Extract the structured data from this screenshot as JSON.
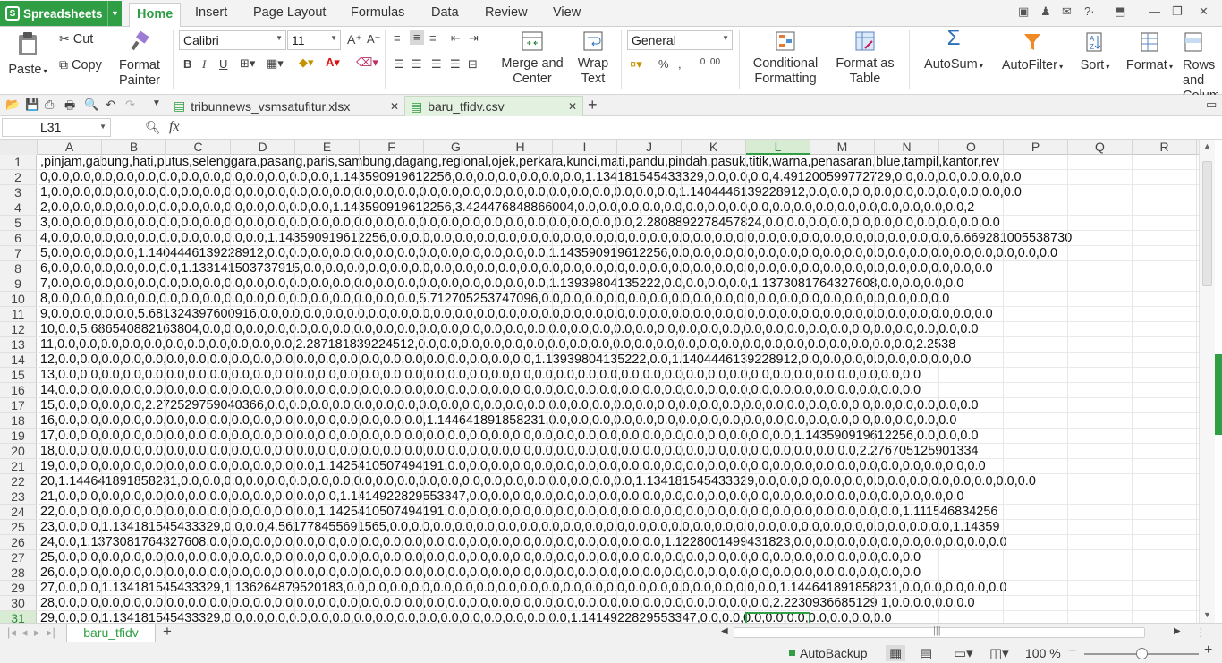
{
  "app": {
    "name": "Spreadsheets",
    "menu": [
      "Home",
      "Insert",
      "Page Layout",
      "Formulas",
      "Data",
      "Review",
      "View"
    ]
  },
  "ribbon": {
    "paste": "Paste",
    "cut": "Cut",
    "copy": "Copy",
    "format_painter": "Format Painter",
    "font_name": "Calibri",
    "font_size": "11",
    "merge_center": "Merge and Center",
    "wrap_text": "Wrap Text",
    "number_format": "General",
    "conditional_formatting": "Conditional Formatting",
    "format_as_table": "Format as Table",
    "autosum": "AutoSum",
    "autofilter": "AutoFilter",
    "sort": "Sort",
    "format": "Format",
    "rows_cols": "Rows and Columns"
  },
  "doc_tabs": [
    {
      "name": "tribunnews_vsmsatufitur.xlsx",
      "active": false
    },
    {
      "name": "baru_tfidv.csv",
      "active": true
    }
  ],
  "formula_bar": {
    "cell_ref": "L31",
    "fx": "fx",
    "value": ""
  },
  "columns": [
    "A",
    "B",
    "C",
    "D",
    "E",
    "F",
    "G",
    "H",
    "I",
    "J",
    "K",
    "L",
    "M",
    "N",
    "O",
    "P",
    "Q",
    "R"
  ],
  "selected_column": "L",
  "rows": [
    {
      "n": "1",
      "text": ",pinjam,gabung,hati,putus,selenggara,pasang,paris,sambung,dagang,regional,ojek,perkara,kunci,mati,pandu,pindah,pasuk,titik,warna,penasaran,blue,tampil,kantor,rev"
    },
    {
      "n": "2",
      "text": "0,0.0,0.0,0.0,0.0,0.0,0.0,0.0,0.0,0.0,0.0,0.0,0.0,0.0,1.143590919612256,0.0,0.0,0.0,0.0,0.0,0.0,1.134181545433329,0.0,0.0,0.0,4.491200599772729,0.0,0.0,0.0,0.0,0.0,0.0"
    },
    {
      "n": "3",
      "text": "1,0.0,0.0,0.0,0.0,0.0,0.0,0.0,0.0,0.0,0.0,0.0,0.0,0.0,0.0,0.0,0.0,0.0,0.0,0.0,0.0,0.0,0.0,0.0,0.0,0.0,0.0,0.0,0.0,0.0,1.1404446139228912,0.0,0.0,0.0,0.0,0.0,0.0,0.0,0.0,0.0,0.0"
    },
    {
      "n": "4",
      "text": "2,0.0,0.0,0.0,0.0,0.0,0.0,0.0,0.0,0.0,0.0,0.0,0.0,0.0,1.143590919612256,3.424476848866004,0.0,0.0,0.0,0.0,0.0,0.0,0.0,0.0,0.0,0.0,0.0,0.0,0.0,0.0,0.0,0.0,0.0,0.0,2"
    },
    {
      "n": "5",
      "text": "3,0.0,0.0,0.0,0.0,0.0,0.0,0.0,0.0,0.0,0.0,0.0,0.0,0.0,0.0,0.0,0.0,0.0,0.0,0.0,0.0,0.0,0.0,0.0,0.0,0.0,0.0,0.0,2.2808892278457824,0.0,0.0,0.0,0.0,0.0,0.0,0.0,0.0,0.0,0.0,0.0"
    },
    {
      "n": "6",
      "text": "4,0.0,0.0,0.0,0.0,0.0,0.0,0.0,0.0,0.0,0.0,1.143590919612256,0.0,0.0,0.0,0.0,0.0,0.0,0.0,0.0,0.0,0.0,0.0,0.0,0.0,0.0,0.0,0.0,0.0,0.0,0.0,0.0,0.0,0.0,0.0,0.0,0.0,0.0,6.669281005538730"
    },
    {
      "n": "7",
      "text": "5,0.0,0.0,0.0,0.0,1.1404446139228912,0.0,0.0,0.0,0.0,0.0,0.0,0.0,0.0,0.0,0.0,0.0,0.0,0.0,1.143590919612256,0.0,0.0,0.0,0.0,0.0,0.0,0.0,0.0,0.0,0.0,0.0,0.0,0.0,0.0,0.0,0.0,0.0,0.0"
    },
    {
      "n": "8",
      "text": "6,0.0,0.0,0.0,0.0,0.0,0.0,1.133141503737915,0.0,0.0,0.0,0.0,0.0,0.0,0.0,0.0,0.0,0.0,0.0,0.0,0.0,0.0,0.0,0.0,0.0,0.0,0.0,0.0,0.0,0.0,0.0,0.0,0.0,0.0,0.0,0.0,0.0,0.0,0.0,0.0"
    },
    {
      "n": "9",
      "text": "7,0.0,0.0,0.0,0.0,0.0,0.0,0.0,0.0,0.0,0.0,0.0,0.0,0.0,0.0,0.0,0.0,0.0,0.0,0.0,0.0,0.0,0.0,0.0,1.13939804135222,0.0,0.0,0.0,0.0,1.1373081764327608,0.0,0.0,0.0,0.0"
    },
    {
      "n": "10",
      "text": "8,0.0,0.0,0.0,0.0,0.0,0.0,0.0,0.0,0.0,0.0,0.0,0.0,0.0,0.0,0.0,0.0,0.0,5.712705253747096,0.0,0.0,0.0,0.0,0.0,0.0,0.0,0.0,0.0,0.0,0.0,0.0,0.0,0.0,0.0,0.0,0.0,0.0,0.0"
    },
    {
      "n": "11",
      "text": "9,0.0,0.0,0.0,0.0,5.681324397600916,0.0,0.0,0.0,0.0,0.0,0.0,0.0,0.0,0.0,0.0,0.0,0.0,0.0,0.0,0.0,0.0,0.0,0.0,0.0,0.0,0.0,0.0,0.0,0.0,0.0,0.0,0.0,0.0,0.0,0.0,0.0,0.0,0.0,0.0"
    },
    {
      "n": "12",
      "text": "10,0.0,5.686540882163804,0.0,0.0,0.0,0.0,0.0,0.0,0.0,0.0,0.0,0.0,0.0,0.0,0.0,0.0,0.0,0.0,0.0,0.0,0.0,0.0,0.0,0.0,0.0,0.0,0.0,0.0,0.0,0.0,0.0,0.0,0.0,0.0,0.0,0.0,0.0,0.0"
    },
    {
      "n": "13",
      "text": "11,0.0,0.0,0.0,0.0,0.0,0.0,0.0,0.0,0.0,0.0,0.0,2.287181839224512,0.0,0.0,0.0,0.0,0.0,0.0,0.0,0.0,0.0,0.0,0.0,0.0,0.0,0.0,0.0,0.0,0.0,0.0,0.0,0.0,0.0,0.0,0.0,2.2538"
    },
    {
      "n": "14",
      "text": "12,0.0,0.0,0.0,0.0,0.0,0.0,0.0,0.0,0.0,0.0,0.0,0.0,0.0,0.0,0.0,0.0,0.0,0.0,0.0,0.0,0.0,0.0,1.13939804135222,0.0,1.1404446139228912,0.0,0.0,0.0,0.0,0.0,0.0,0.0,0.0"
    },
    {
      "n": "15",
      "text": "13,0.0,0.0,0.0,0.0,0.0,0.0,0.0,0.0,0.0,0.0,0.0,0.0,0.0,0.0,0.0,0.0,0.0,0.0,0.0,0.0,0.0,0.0,0.0,0.0,0.0,0.0,0.0,0.0,0.0,0.0,0.0,0.0,0.0,0.0,0.0,0.0,0.0,0.0,0.0,0.0"
    },
    {
      "n": "16",
      "text": "14,0.0,0.0,0.0,0.0,0.0,0.0,0.0,0.0,0.0,0.0,0.0,0.0,0.0,0.0,0.0,0.0,0.0,0.0,0.0,0.0,0.0,0.0,0.0,0.0,0.0,0.0,0.0,0.0,0.0,0.0,0.0,0.0,0.0,0.0,0.0,0.0,0.0,0.0,0.0,0.0"
    },
    {
      "n": "17",
      "text": "15,0.0,0.0,0.0,0.0,2.272529759040366,0.0,0.0,0.0,0.0,0.0,0.0,0.0,0.0,0.0,0.0,0.0,0.0,0.0,0.0,0.0,0.0,0.0,0.0,0.0,0.0,0.0,0.0,0.0,0.0,0.0,0.0,0.0,0.0,0.0,0.0,0.0,0.0,0.0"
    },
    {
      "n": "18",
      "text": "16,0.0,0.0,0.0,0.0,0.0,0.0,0.0,0.0,0.0,0.0,0.0,0.0,0.0,0.0,0.0,0.0,0.0,1.144641891858231,0.0,0.0,0.0,0.0,0.0,0.0,0.0,0.0,0.0,0.0,0.0,0.0,0.0,0.0,0.0,0.0,0.0,0.0,0.0"
    },
    {
      "n": "19",
      "text": "17,0.0,0.0,0.0,0.0,0.0,0.0,0.0,0.0,0.0,0.0,0.0,0.0,0.0,0.0,0.0,0.0,0.0,0.0,0.0,0.0,0.0,0.0,0.0,0.0,0.0,0.0,0.0,0.0,0.0,0.0,0.0,0.0,0.0,0.0,1.143590919612256,0.0,0.0,0.0"
    },
    {
      "n": "20",
      "text": "18,0.0,0.0,0.0,0.0,0.0,0.0,0.0,0.0,0.0,0.0,0.0,0.0,0.0,0.0,0.0,0.0,0.0,0.0,0.0,0.0,0.0,0.0,0.0,0.0,0.0,0.0,0.0,0.0,0.0,0.0,0.0,0.0,0.0,0.0,0.0,0.0,0.0,2.276705125901334"
    },
    {
      "n": "21",
      "text": "19,0.0,0.0,0.0,0.0,0.0,0.0,0.0,0.0,0.0,0.0,0.0,0.0,1.1425410507494191,0.0,0.0,0.0,0.0,0.0,0.0,0.0,0.0,0.0,0.0,0.0,0.0,0.0,0.0,0.0,0.0,0.0,0.0,0.0,0.0,0.0,0.0,0.0,0.0,0.0"
    },
    {
      "n": "22",
      "text": "20,1.144641891858231,0.0,0.0,0.0,0.0,0.0,0.0,0.0,0.0,0.0,0.0,0.0,0.0,0.0,0.0,0.0,0.0,0.0,0.0,0.0,0.0,0.0,1.134181545433329,0.0,0.0,0.0,0.0,0.0,0.0,0.0,0.0,0.0,0.0,0.0,0.0,0.0"
    },
    {
      "n": "23",
      "text": "21,0.0,0.0,0.0,0.0,0.0,0.0,0.0,0.0,0.0,0.0,0.0,0.0,0.0,1.1414922829553347,0.0,0.0,0.0,0.0,0.0,0.0,0.0,0.0,0.0,0.0,0.0,0.0,0.0,0.0,0.0,0.0,0.0,0.0,0.0,0.0,0.0,0.0,0.0"
    },
    {
      "n": "24",
      "text": "22,0.0,0.0,0.0,0.0,0.0,0.0,0.0,0.0,0.0,0.0,0.0,0.0,1.1425410507494191,0.0,0.0,0.0,0.0,0.0,0.0,0.0,0.0,0.0,0.0,0.0,0.0,0.0,0.0,0.0,0.0,0.0,0.0,0.0,0.0,0.0,1.111546834256"
    },
    {
      "n": "25",
      "text": "23,0.0,0.0,1.134181545433329,0.0,0.0,4.561778455691565,0.0,0.0,0.0,0.0,0.0,0.0,0.0,0.0,0.0,0.0,0.0,0.0,0.0,0.0,0.0,0.0,0.0,0.0,0.0,0.0,0.0,0.0,0.0,0.0,0.0,0.0,1.14359"
    },
    {
      "n": "26",
      "text": "24,0.0,1.1373081764327608,0.0,0.0,0.0,0.0,0.0,0.0,0.0,0.0,0.0,0.0,0.0,0.0,0.0,0.0,0.0,0.0,0.0,0.0,0.0,0.0,0.0,1.1228001499431823,0.0,0.0,0.0,0.0,0.0,0.0,0.0,0.0,0.0,0.0"
    },
    {
      "n": "27",
      "text": "25,0.0,0.0,0.0,0.0,0.0,0.0,0.0,0.0,0.0,0.0,0.0,0.0,0.0,0.0,0.0,0.0,0.0,0.0,0.0,0.0,0.0,0.0,0.0,0.0,0.0,0.0,0.0,0.0,0.0,0.0,0.0,0.0,0.0,0.0,0.0,0.0,0.0,0.0,0.0,0.0"
    },
    {
      "n": "28",
      "text": "26,0.0,0.0,0.0,0.0,0.0,0.0,0.0,0.0,0.0,0.0,0.0,0.0,0.0,0.0,0.0,0.0,0.0,0.0,0.0,0.0,0.0,0.0,0.0,0.0,0.0,0.0,0.0,0.0,0.0,0.0,0.0,0.0,0.0,0.0,0.0,0.0,0.0,0.0,0.0,0.0"
    },
    {
      "n": "29",
      "text": "27,0.0,0.0,1.134181545433329,1.136264879520183,0.0,0.0,0.0,0.0,0.0,0.0,0.0,0.0,0.0,0.0,0.0,0.0,0.0,0.0,0.0,0.0,0.0,0.0,0.0,0.0,1.144641891858231,0.0,0.0,0.0,0.0,0.0"
    },
    {
      "n": "30",
      "text": "28,0.0,0.0,0.0,0.0,0.0,0.0,0.0,0.0,0.0,0.0,0.0,0.0,0.0,0.0,0.0,0.0,0.0,0.0,0.0,0.0,0.0,0.0,0.0,0.0,0.0,0.0,0.0,0.0,0.0,0.0,0.0,0.0,0.0,2.2230936685129 1,0.0,0.0,0.0,0.0"
    },
    {
      "n": "31",
      "text": "29,0.0,0.0,1.134181545433329,0.0,0.0,0.0,0.0,0.0,0.0,0.0,0.0,0.0,0.0,0.0,0.0,0.0,0.0,0.0,0.0,1.1414922829553347,0.0,0.0,0.0,0.0,0.0,0.0,0.0,0.0,0.0"
    }
  ],
  "selected_row": "31",
  "sheet_tab": "baru_tfidv",
  "status": {
    "autobackup": "AutoBackup",
    "zoom": "100 %"
  }
}
